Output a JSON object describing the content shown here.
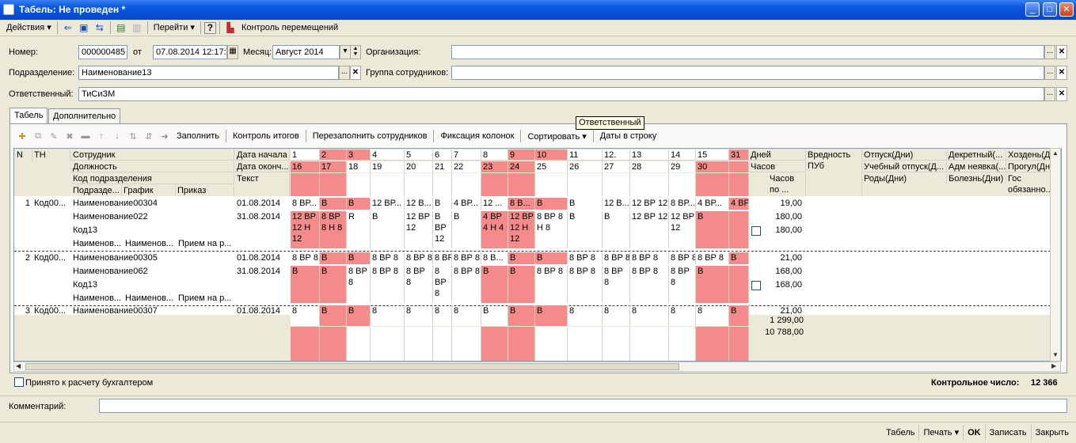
{
  "window": {
    "title": "Табель: Не проведен *",
    "min": "_",
    "max": "□",
    "close": "✕"
  },
  "toolbar": {
    "actions": "Действия",
    "go": "Перейти",
    "help": "?",
    "movement_control": "Контроль перемещений"
  },
  "form": {
    "number_label": "Номер:",
    "number": "000000485",
    "from_label": "от",
    "date": "07.08.2014 12:17:32",
    "month_label": "Месяц:",
    "month": "Август 2014",
    "org_label": "Организация:",
    "org": "",
    "dept_label": "Подразделение:",
    "dept": "Наименование13",
    "group_label": "Группа сотрудников:",
    "group": "",
    "resp_label": "Ответственный:",
    "resp": "ТиСиЗМ"
  },
  "tabs": [
    "Табель",
    "Дополнительно"
  ],
  "table_toolbar": [
    "Заполнить",
    "Контроль итогов",
    "Перезаполнить сотрудников",
    "Фиксация колонок",
    "Сортировать",
    "Даты в строку"
  ],
  "tooltip": "Ответственный",
  "header": {
    "n": "N",
    "tn": "ТН",
    "employee": "Сотрудник",
    "position": "Должность",
    "dept_code": "Код подразделения",
    "subdept": "Подразде...",
    "schedule": "График",
    "order": "Приказ",
    "start": "Дата начала",
    "end": "Дата оконч...",
    "text": "Текст",
    "days_row1": [
      "1",
      "2",
      "3",
      "4",
      "5",
      "6",
      "7",
      "8",
      "9",
      "10",
      "11",
      "12.",
      "13",
      "14",
      "15",
      "31"
    ],
    "days_row2": [
      "16",
      "17",
      "18",
      "19",
      "20",
      "21",
      "22",
      "23",
      "24",
      "25",
      "26",
      "27",
      "28",
      "29",
      "30",
      ""
    ],
    "days": "Дней",
    "hours": "Часов",
    "hours_po": "Часов по ...",
    "harm": "Вредность",
    "pub": "ПУб",
    "vac": "Отпуск(Дни)",
    "study": "Учебный отпуск(Д...",
    "birth": "Роды(Дни)",
    "decr": "Декретный(...",
    "adm": "Адм неявка(...",
    "ill": "Болезнь(Дни)",
    "walk": "Хоздень(Д...",
    "absent": "Прогул(Дн...",
    "gov": "Гос обязанно..."
  },
  "rows": [
    {
      "n": "1",
      "tn": "Код00...",
      "emp": "Наименование00304",
      "pos": "Наименование022",
      "code": "Код13",
      "sub": "Наименов...",
      "sched": "Наименов...",
      "order": "Прием на р...",
      "start": "01.08.2014",
      "end": "31.08.2014",
      "d1": [
        "8 ВР...",
        "В",
        "В",
        "12 ВР...",
        "12 В...",
        "В",
        "4 ВР...",
        "12 ...",
        "8 В...",
        "В",
        "В",
        "12 В...",
        "12 ВР 12",
        "8 ВР...",
        "4 ВР...",
        "4 ВР 4 Н 4"
      ],
      "d2": [
        "12 ВР 12 Н 12",
        "8 ВР 8 Н 8",
        "R",
        "В",
        "12 ВР 12",
        "В ВР 12",
        "В",
        "4 ВР 4 Н 4",
        "12 ВР 12 Н 12",
        "8 ВР 8 Н 8",
        "В",
        "В",
        "12 ВР 12",
        "12 ВР 12",
        "В",
        ""
      ],
      "days": "19,00",
      "hours": "180,00",
      "hours_po": "180,00"
    },
    {
      "n": "2",
      "tn": "Код00...",
      "emp": "Наименование00305",
      "pos": "Наименование062",
      "code": "Код13",
      "sub": "Наименов...",
      "sched": "Наименов...",
      "order": "Прием на р...",
      "start": "01.08.2014",
      "end": "31.08.2014",
      "d1": [
        "8 ВР 8",
        "В",
        "В",
        "8 ВР 8",
        "8 ВР 8",
        "8 ВР 8",
        "8 ВР 8",
        "8 В...",
        "В",
        "В",
        "8 ВР 8",
        "8 ВР 8",
        "8 ВР 8",
        "8 ВР 8",
        "8 ВР 8",
        "В"
      ],
      "d2": [
        "В",
        "В",
        "8 ВР 8",
        "8 ВР 8",
        "8 ВР 8",
        "8 ВР 8",
        "8 ВР 8",
        "В",
        "В",
        "8 ВР 8",
        "8 ВР 8",
        "8 ВР 8",
        "8 ВР 8",
        "8 ВР 8",
        "В",
        ""
      ],
      "days": "21,00",
      "hours": "168,00",
      "hours_po": "168,00"
    },
    {
      "n": "3",
      "tn": "Код00...",
      "emp": "Наименование00307",
      "start": "01.08.2014",
      "d1": [
        "8",
        "В",
        "В",
        "8",
        "8",
        "8",
        "8",
        "В",
        "В",
        "В",
        "8",
        "8",
        "8",
        "8",
        "8",
        "В"
      ],
      "days": "21,00"
    }
  ],
  "totals": {
    "days": "1 299,00",
    "hours": "10 788,00"
  },
  "accepted_label": "Принято к расчету бухгалтером",
  "control_label": "Контрольное число:",
  "control_value": "12 366",
  "comment_label": "Комментарий:",
  "comment": "",
  "status": [
    "Табель",
    "Печать",
    "OK",
    "Записать",
    "Закрыть"
  ],
  "colors": {
    "weekend": "#F58A8A",
    "title": "#0A5ADF"
  }
}
